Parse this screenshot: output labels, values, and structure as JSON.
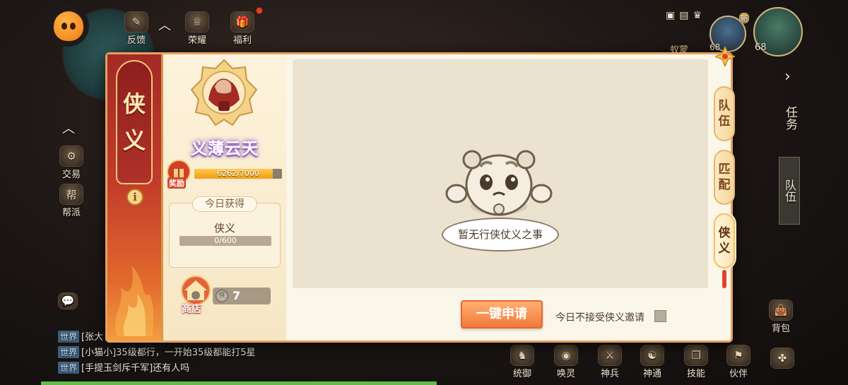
{
  "hud": {
    "top": [
      {
        "name": "feedback",
        "label": "反馈"
      },
      {
        "name": "glory",
        "label": "荣耀"
      },
      {
        "name": "welfare",
        "label": "福利"
      }
    ],
    "left": [
      {
        "name": "trade",
        "label": "交易"
      },
      {
        "name": "guild",
        "label": "帮派",
        "icon_text": "帮"
      }
    ],
    "right_task_label": "任务",
    "right_team_label": "队伍",
    "level_left": "68",
    "level_right": "68",
    "player_name_partial": "蚁蒙",
    "bottom": [
      {
        "name": "tongyu",
        "label": "统御"
      },
      {
        "name": "summon",
        "label": "唤灵"
      },
      {
        "name": "divine-weapon",
        "label": "神兵"
      },
      {
        "name": "shentong",
        "label": "神通"
      },
      {
        "name": "skill",
        "label": "技能"
      },
      {
        "name": "companion",
        "label": "伙伴"
      }
    ],
    "bag_label": "背包",
    "new_badge": "新"
  },
  "chat": [
    {
      "tag": "世界",
      "text": "[张大"
    },
    {
      "tag": "世界",
      "text": "[小猫小]35级都行，一开始35级都能打5星"
    },
    {
      "tag": "世界",
      "text": "[手提玉剑斥千军]还有人吗"
    }
  ],
  "panel": {
    "banner_title": [
      "侠",
      "义"
    ],
    "info_icon": "i",
    "rank_name": "义薄云天",
    "reward_label": "奖励",
    "progress": {
      "text": "6262/7000",
      "current": 6262,
      "max": 7000
    },
    "today": {
      "title": "今日获得",
      "item": "侠义",
      "progress_text": "0/600"
    },
    "shop": {
      "label": "商店",
      "badge_char": "侠",
      "coin_char": "侠",
      "coin_value": "7"
    },
    "empty_message": "暂无行侠仗义之事",
    "apply_button": "一键申请",
    "decline_label": "今日不接受侠义邀请",
    "decline_checked": false,
    "tabs": [
      {
        "name": "team",
        "label": [
          "队",
          "伍"
        ],
        "active": false
      },
      {
        "name": "match",
        "label": [
          "匹",
          "配"
        ],
        "active": false
      },
      {
        "name": "chivalry",
        "label": [
          "侠",
          "义"
        ],
        "active": true
      }
    ]
  }
}
